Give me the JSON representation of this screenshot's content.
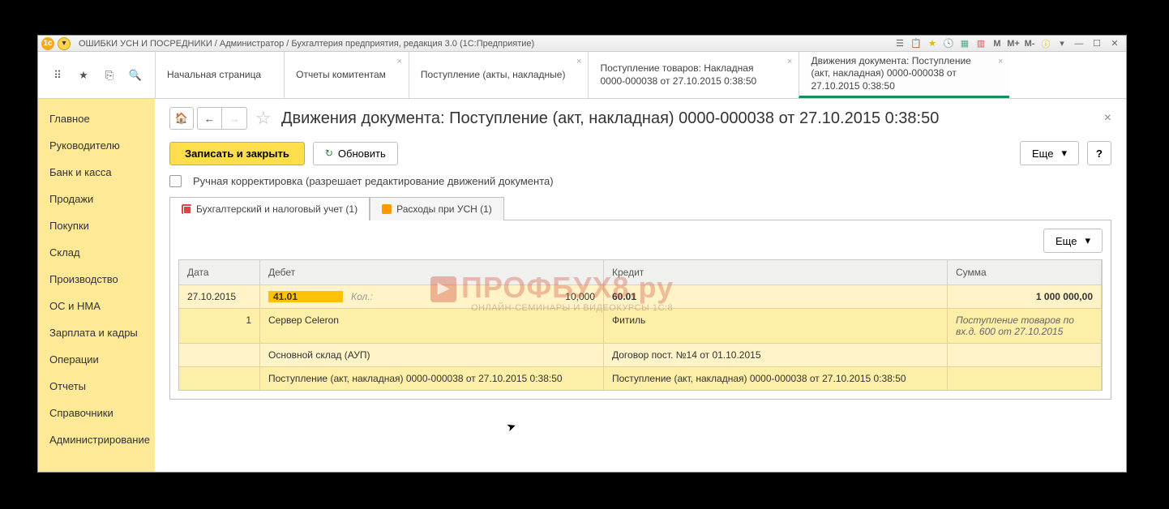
{
  "titlebar": {
    "title": "ОШИБКИ УСН И ПОСРЕДНИКИ / Администратор / Бухгалтерия предприятия, редакция 3.0  (1С:Предприятие)",
    "m": "М",
    "m_plus": "М+",
    "m_minus": "М-"
  },
  "open_tabs": [
    {
      "label": "Начальная страница",
      "closable": false
    },
    {
      "label": "Отчеты комитентам",
      "closable": true
    },
    {
      "label": "Поступление (акты, накладные)",
      "closable": true
    },
    {
      "label": "Поступление товаров: Накладная 0000-000038 от 27.10.2015 0:38:50",
      "closable": true
    },
    {
      "label": "Движения документа: Поступление (акт, накладная) 0000-000038 от 27.10.2015 0:38:50",
      "closable": true,
      "active": true
    }
  ],
  "sidebar": {
    "items": [
      "Главное",
      "Руководителю",
      "Банк и касса",
      "Продажи",
      "Покупки",
      "Склад",
      "Производство",
      "ОС и НМА",
      "Зарплата и кадры",
      "Операции",
      "Отчеты",
      "Справочники",
      "Администрирование"
    ]
  },
  "page": {
    "title": "Движения документа: Поступление (акт, накладная) 0000-000038 от 27.10.2015 0:38:50",
    "save_close": "Записать и закрыть",
    "refresh": "Обновить",
    "more": "Еще",
    "help": "?",
    "manual_edit": "Ручная корректировка (разрешает редактирование движений документа)"
  },
  "subtabs": [
    {
      "label": "Бухгалтерский и налоговый учет (1)",
      "active": true
    },
    {
      "label": "Расходы при УСН (1)",
      "active": false
    }
  ],
  "inner": {
    "more": "Еще"
  },
  "table": {
    "headers": {
      "date": "Дата",
      "debit": "Дебет",
      "credit": "Кредит",
      "sum": "Сумма"
    },
    "rows": [
      {
        "date": "27.10.2015",
        "num": "1",
        "debit_acc": "41.01",
        "qty_label": "Кол.:",
        "qty": "10,000",
        "credit_acc": "60.01",
        "sum": "1 000 000,00"
      },
      {
        "debit_text": "Сервер Celeron",
        "credit_text": "Фитиль",
        "sum_text": "Поступление товаров по вх.д. 600 от 27.10.2015"
      },
      {
        "debit_text": "Основной склад (АУП)",
        "credit_text": "Договор пост. №14 от 01.10.2015"
      },
      {
        "debit_text": "Поступление (акт, накладная) 0000-000038 от 27.10.2015 0:38:50",
        "credit_text": "Поступление (акт, накладная) 0000-000038 от 27.10.2015 0:38:50"
      }
    ]
  },
  "watermark": {
    "main": "ПРОФБУХ8.ру",
    "sub": "ОНЛАЙН-СЕМИНАРЫ И ВИДЕОКУРСЫ 1С:8"
  }
}
